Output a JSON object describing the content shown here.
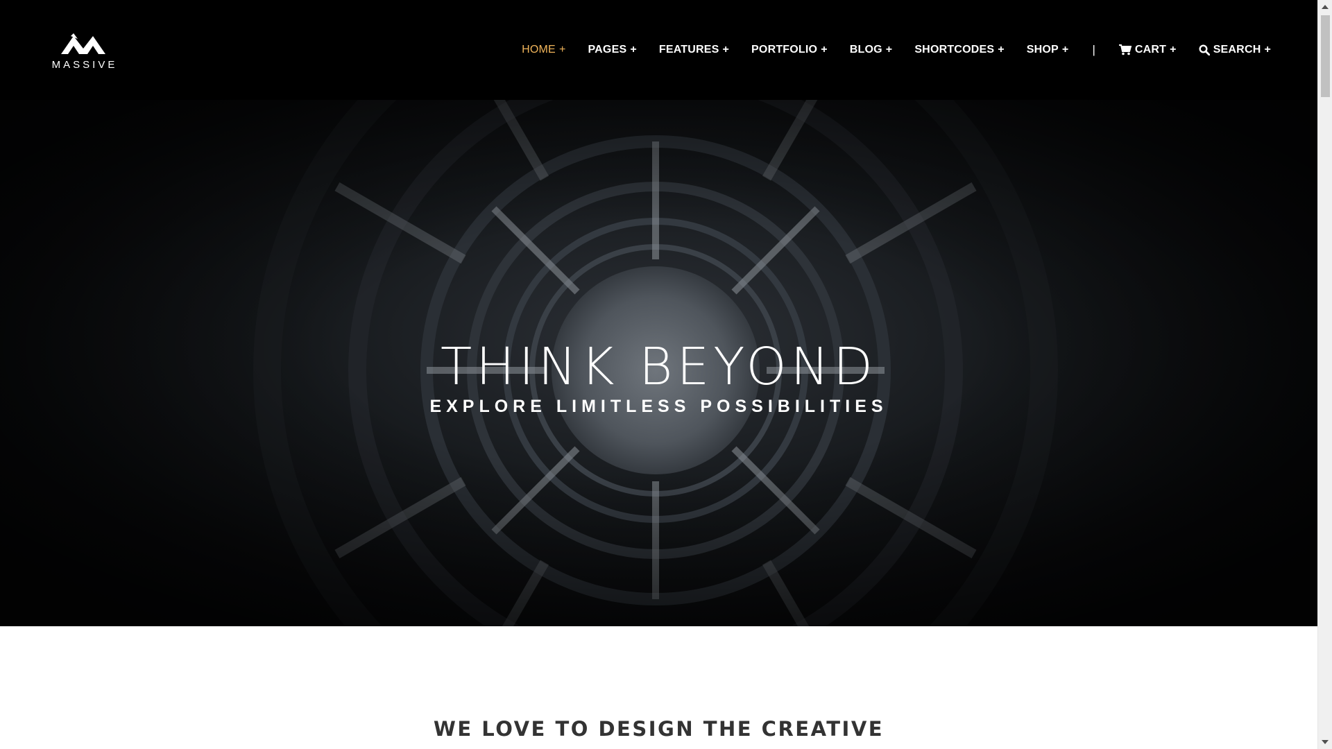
{
  "brand": {
    "name": "MASSIVE",
    "logo_icon": "mountain-logo-icon"
  },
  "nav": {
    "items": [
      {
        "label": "HOME",
        "suffix": "+",
        "active": true
      },
      {
        "label": "PAGES",
        "suffix": "+"
      },
      {
        "label": "FEATURES",
        "suffix": "+"
      },
      {
        "label": "PORTFOLIO",
        "suffix": "+"
      },
      {
        "label": "BLOG",
        "suffix": "+"
      },
      {
        "label": "SHORTCODES",
        "suffix": "+"
      },
      {
        "label": "SHOP",
        "suffix": "+"
      }
    ],
    "separator": "|",
    "cart": {
      "label": "CART",
      "suffix": "+",
      "icon": "cart-icon"
    },
    "search": {
      "label": "SEARCH",
      "suffix": "+",
      "icon": "search-icon"
    }
  },
  "hero": {
    "title": "THINK BEYOND",
    "subtitle": "EXPLORE LIMITLESS POSSIBILITIES"
  },
  "section": {
    "title": "WE LOVE TO DESIGN THE CREATIVE"
  },
  "colors": {
    "header_bg": "#000000",
    "active_nav": "#f0b45a",
    "text_light": "#ffffff",
    "section_title": "#333333"
  }
}
